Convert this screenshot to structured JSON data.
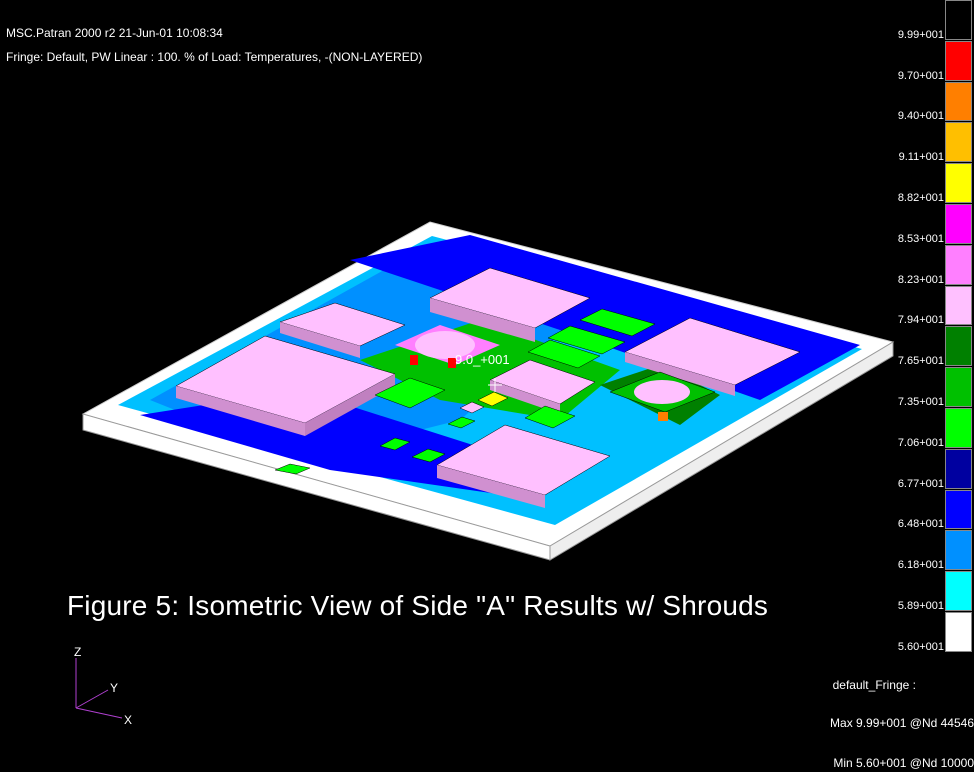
{
  "header": {
    "line1": "MSC.Patran 2000 r2 21-Jun-01 10:08:34",
    "line2": "Fringe: Default, PW Linear : 100. % of Load: Temperatures, -(NON-LAYERED)"
  },
  "caption": "Figure 5: Isometric View of Side \"A\" Results w/ Shrouds",
  "probe_label": "9.0_+001",
  "legend": {
    "colors": [
      "#000000",
      "#ff0000",
      "#ff7f00",
      "#ffbf00",
      "#ffff00",
      "#ff00ff",
      "#ff7fff",
      "#ffc0ff",
      "#008000",
      "#00c000",
      "#00ff00",
      "#0000a0",
      "#0000ff",
      "#0090ff",
      "#00ffff",
      "#ffffff"
    ],
    "labels": [
      "9.99+001",
      "9.70+001",
      "9.40+001",
      "9.11+001",
      "8.82+001",
      "8.53+001",
      "8.23+001",
      "7.94+001",
      "7.65+001",
      "7.35+001",
      "7.06+001",
      "6.77+001",
      "6.48+001",
      "6.18+001",
      "5.89+001",
      "5.60+001"
    ]
  },
  "fringe_name": "default_Fringe :",
  "max_text": "Max 9.99+001 @Nd 44546",
  "min_text": "Min 5.60+001 @Nd 10000",
  "axes": {
    "z": "Z",
    "y": "Y",
    "x": "X"
  }
}
